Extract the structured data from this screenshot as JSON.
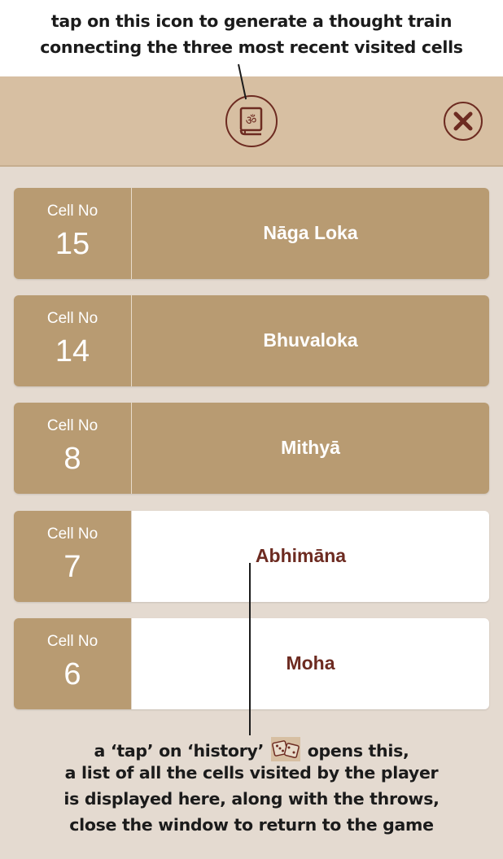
{
  "annotations": {
    "top": [
      "tap on this icon to generate a thought train",
      "connecting the three most recent visited cells"
    ],
    "bottom_line1_a": "a ‘tap’ on  ‘history’",
    "bottom_line1_b": "opens this,",
    "bottom_lines": [
      "a list of all the cells visited by the player",
      "is displayed here, along with the throws,",
      "close the window to return to the game"
    ]
  },
  "header": {
    "journal_icon": "om-book-icon",
    "close_icon": "close-x-icon"
  },
  "history": [
    {
      "label": "Cell No",
      "number": "15",
      "name": "Nāga Loka",
      "state": "active"
    },
    {
      "label": "Cell No",
      "number": "14",
      "name": "Bhuvaloka",
      "state": "active"
    },
    {
      "label": "Cell No",
      "number": "8",
      "name": "Mithyā",
      "state": "active"
    },
    {
      "label": "Cell No",
      "number": "7",
      "name": "Abhimāna",
      "state": "inactive"
    },
    {
      "label": "Cell No",
      "number": "6",
      "name": "Moha",
      "state": "inactive"
    }
  ],
  "colors": {
    "background": "#e4dad0",
    "header": "#d7bfa2",
    "row_tan": "#b89b72",
    "accent_maroon": "#6d2b21"
  }
}
